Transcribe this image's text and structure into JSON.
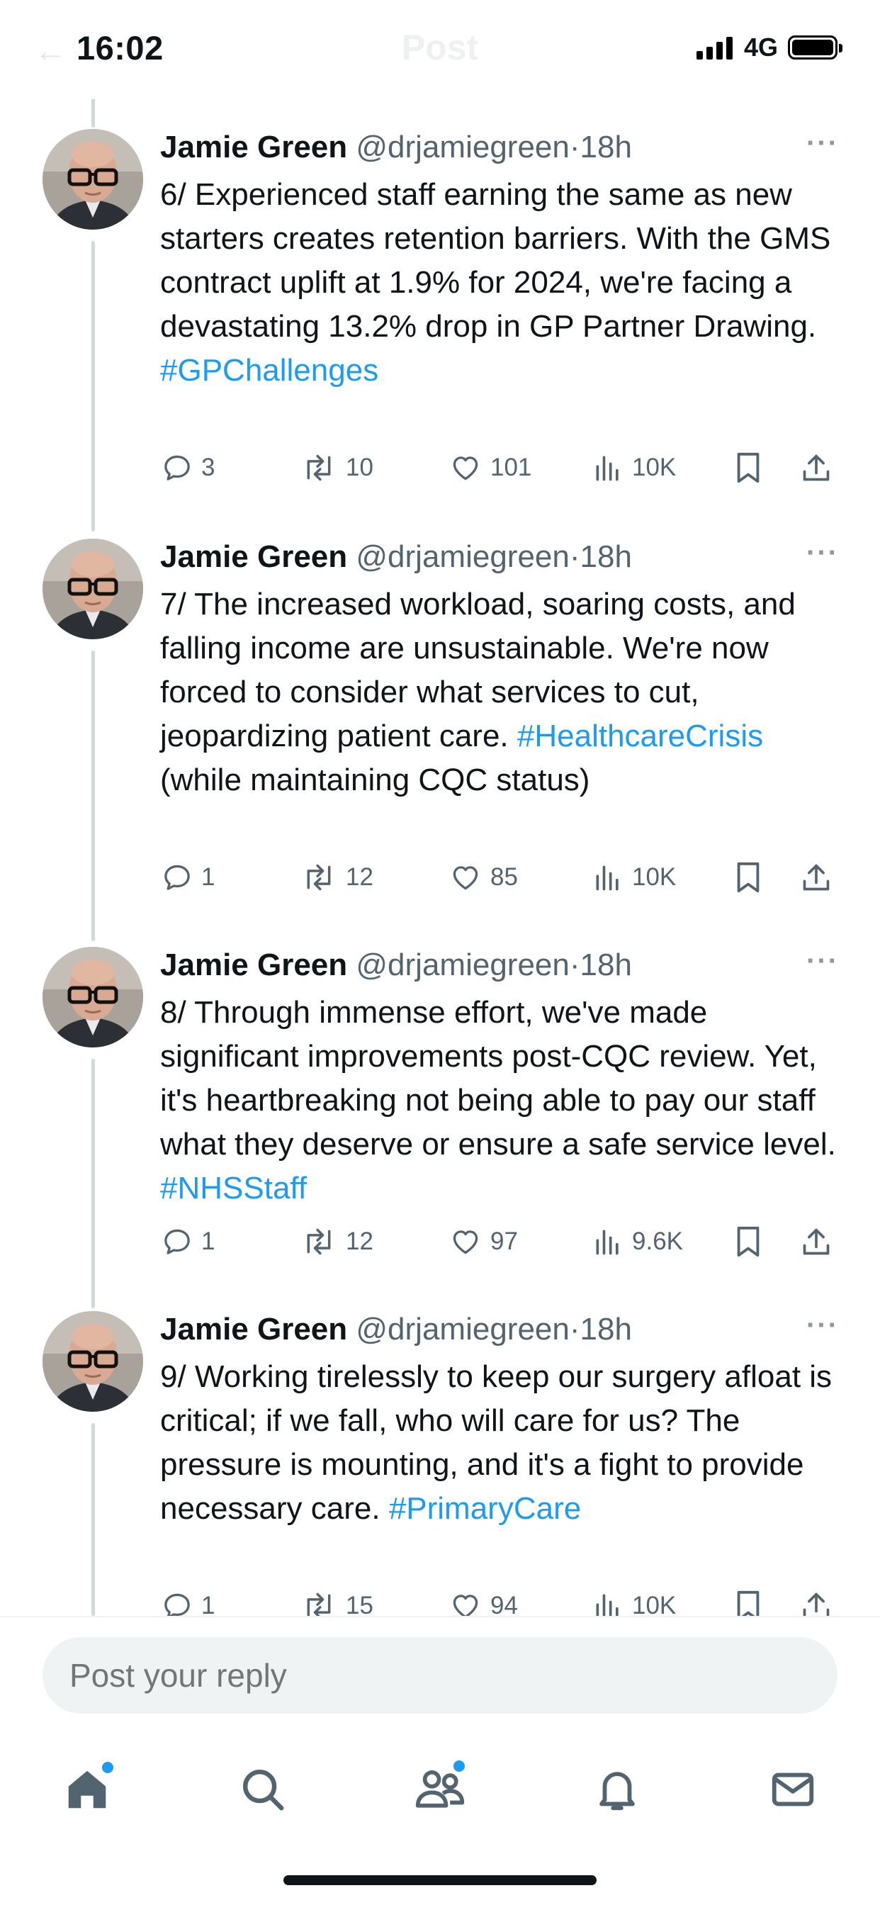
{
  "status_bar": {
    "time": "16:02",
    "network": "4G",
    "back_ghost": "←",
    "title_ghost": "Post"
  },
  "tweets": [
    {
      "author": "Jamie Green",
      "handle": "@drjamiegreen",
      "separator": "·",
      "time_ago": "18h",
      "more": "···",
      "text": "6/ Experienced staff earning the same as new starters creates retention barriers. With the GMS contract uplift at 1.9% for 2024, we're facing a devastating 13.2% drop in GP Partner Drawing. ",
      "hashtag": "#GPChallenges",
      "text_after": "",
      "replies": "3",
      "reposts": "10",
      "likes": "101",
      "views": "10K"
    },
    {
      "author": "Jamie Green",
      "handle": "@drjamiegreen",
      "separator": "·",
      "time_ago": "18h",
      "more": "···",
      "text": "7/ The increased workload, soaring costs, and falling income are unsustainable. We're now forced to consider what services to cut, jeopardizing patient care. ",
      "hashtag": "#HealthcareCrisis",
      "text_after": " (while maintaining CQC status)",
      "replies": "1",
      "reposts": "12",
      "likes": "85",
      "views": "10K"
    },
    {
      "author": "Jamie Green",
      "handle": "@drjamiegreen",
      "separator": "·",
      "time_ago": "18h",
      "more": "···",
      "text": "8/ Through immense effort, we've made significant improvements post-CQC review. Yet, it's heartbreaking not being able to pay our staff what they deserve or ensure a safe service level. ",
      "hashtag": "#NHSStaff",
      "text_after": "",
      "replies": "1",
      "reposts": "12",
      "likes": "97",
      "views": "9.6K"
    },
    {
      "author": "Jamie Green",
      "handle": "@drjamiegreen",
      "separator": "·",
      "time_ago": "18h",
      "more": "···",
      "text": "9/ Working tirelessly to keep our surgery afloat is critical; if we fall, who will care for us? The pressure is mounting, and it's a fight to provide necessary care. ",
      "hashtag": "#PrimaryCare",
      "text_after": "",
      "replies": "1",
      "reposts": "15",
      "likes": "94",
      "views": "10K"
    }
  ],
  "reply_bar": {
    "placeholder": "Post your reply"
  },
  "tab_bar": {
    "items": [
      "home-icon",
      "search-icon",
      "communities-icon",
      "notifications-icon",
      "messages-icon"
    ]
  },
  "colors": {
    "accent": "#1d9bf0",
    "text": "#0f1419",
    "secondary": "#536471",
    "thread_line": "#cfd9de"
  }
}
